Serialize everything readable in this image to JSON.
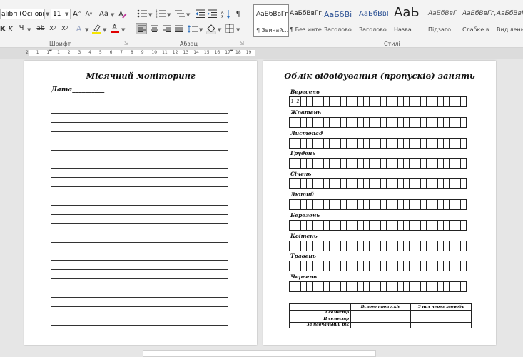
{
  "ribbon": {
    "font_name": "alibri (Основний",
    "font_size": "11",
    "groups": {
      "font": "Шрифт",
      "paragraph": "Абзац",
      "styles": "Стилі"
    },
    "font_buttons": {
      "grow": "A",
      "shrink": "A",
      "case": "Aa",
      "bold": "K",
      "italic": "K",
      "underline": "Ч",
      "strike": "ab",
      "subscript": "x",
      "superscript": "x",
      "color": "A"
    },
    "styles": [
      {
        "sample": "АаБбВвГг,",
        "name": "¶ Звичай...",
        "selected": true
      },
      {
        "sample": "АаБбВвГг,",
        "name": "¶ Без инте..."
      },
      {
        "sample": "АаБбВі",
        "name": "Заголово..."
      },
      {
        "sample": "АаБбВвІ",
        "name": "Заголово..."
      },
      {
        "sample": "АаЬ",
        "name": "Назва"
      },
      {
        "sample": "АаБбВвГ",
        "name": "Підзаго..."
      },
      {
        "sample": "АаБбВвГг,",
        "name": "Слабке в..."
      },
      {
        "sample": "АаБбВвГг",
        "name": "Виділення"
      }
    ]
  },
  "ruler": {
    "ticks": [
      "2",
      "1",
      "1",
      "1",
      "2",
      "3",
      "4",
      "5",
      "6",
      "7",
      "8",
      "9",
      "10",
      "11",
      "12",
      "13",
      "14",
      "15",
      "16",
      "17",
      "18",
      "19"
    ]
  },
  "pages": {
    "left": {
      "title": "Місячний моніторинг",
      "date_label": "Дата__________",
      "line_count": 25
    },
    "right": {
      "title": "Облік відвідування (пропусків) занять",
      "months": [
        "Вересень",
        "Жовтень",
        "Листопад",
        "Грудень",
        "Січень",
        "Лютий",
        "Березень",
        "Квітень",
        "Травень",
        "Червень"
      ],
      "days_per_row": 31,
      "first_cells": [
        "1",
        "2"
      ],
      "summary": {
        "headers": [
          "Всього пропусків",
          "З них через хворобу"
        ],
        "rows": [
          "I семестр",
          "II семестр",
          "За навчальний рік"
        ]
      }
    }
  }
}
